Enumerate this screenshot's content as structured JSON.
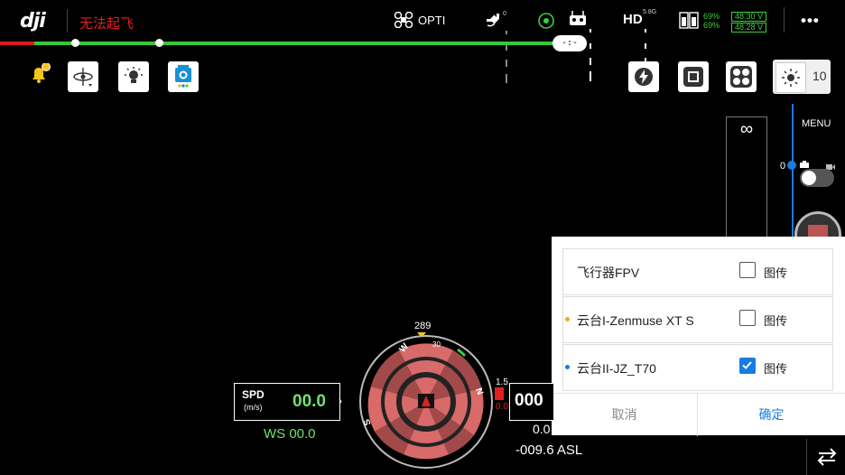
{
  "topbar": {
    "logo": "dji",
    "status": "无法起飞",
    "mode": "OPTI",
    "gps_count": "0",
    "hd_label": "HD",
    "hd_freq": "5.8G",
    "battery_pct_1": "69%",
    "battery_pct_2": "69%",
    "voltage_1": "48.30 V",
    "voltage_2": "48.28 V",
    "more": "•••"
  },
  "progress": {
    "time": "-:-"
  },
  "camera": {
    "shutter_value": "10",
    "menu_label": "MENU",
    "zoom_symbol": "∞",
    "zoom_level": "0"
  },
  "compass": {
    "heading": "289",
    "dir_w": "W",
    "dir_n": "N",
    "dir_s": "S",
    "tick_30": "30"
  },
  "telemetry": {
    "spd_label": "SPD",
    "spd_unit": "(m/s)",
    "spd_value": "00.0",
    "ws": "WS 00.0",
    "alt_value": "000",
    "alt_small": "1.5",
    "alt_red": "0.0",
    "vs": "0.0",
    "asl": "-009.6 ASL"
  },
  "fpv_panel": {
    "rows": [
      {
        "name": "飞行器FPV",
        "bullet": "",
        "checked": false,
        "label": "图传"
      },
      {
        "name": "云台I-Zenmuse XT S",
        "bullet": "#f5a623",
        "checked": false,
        "label": "图传"
      },
      {
        "name": "云台II-JZ_T70",
        "bullet": "#1a7ce0",
        "checked": true,
        "label": "图传"
      }
    ],
    "cancel": "取消",
    "confirm": "确定"
  },
  "colors": {
    "accent": "#1a7ce0",
    "warn": "#e02020",
    "ok": "#3ecf3e"
  }
}
